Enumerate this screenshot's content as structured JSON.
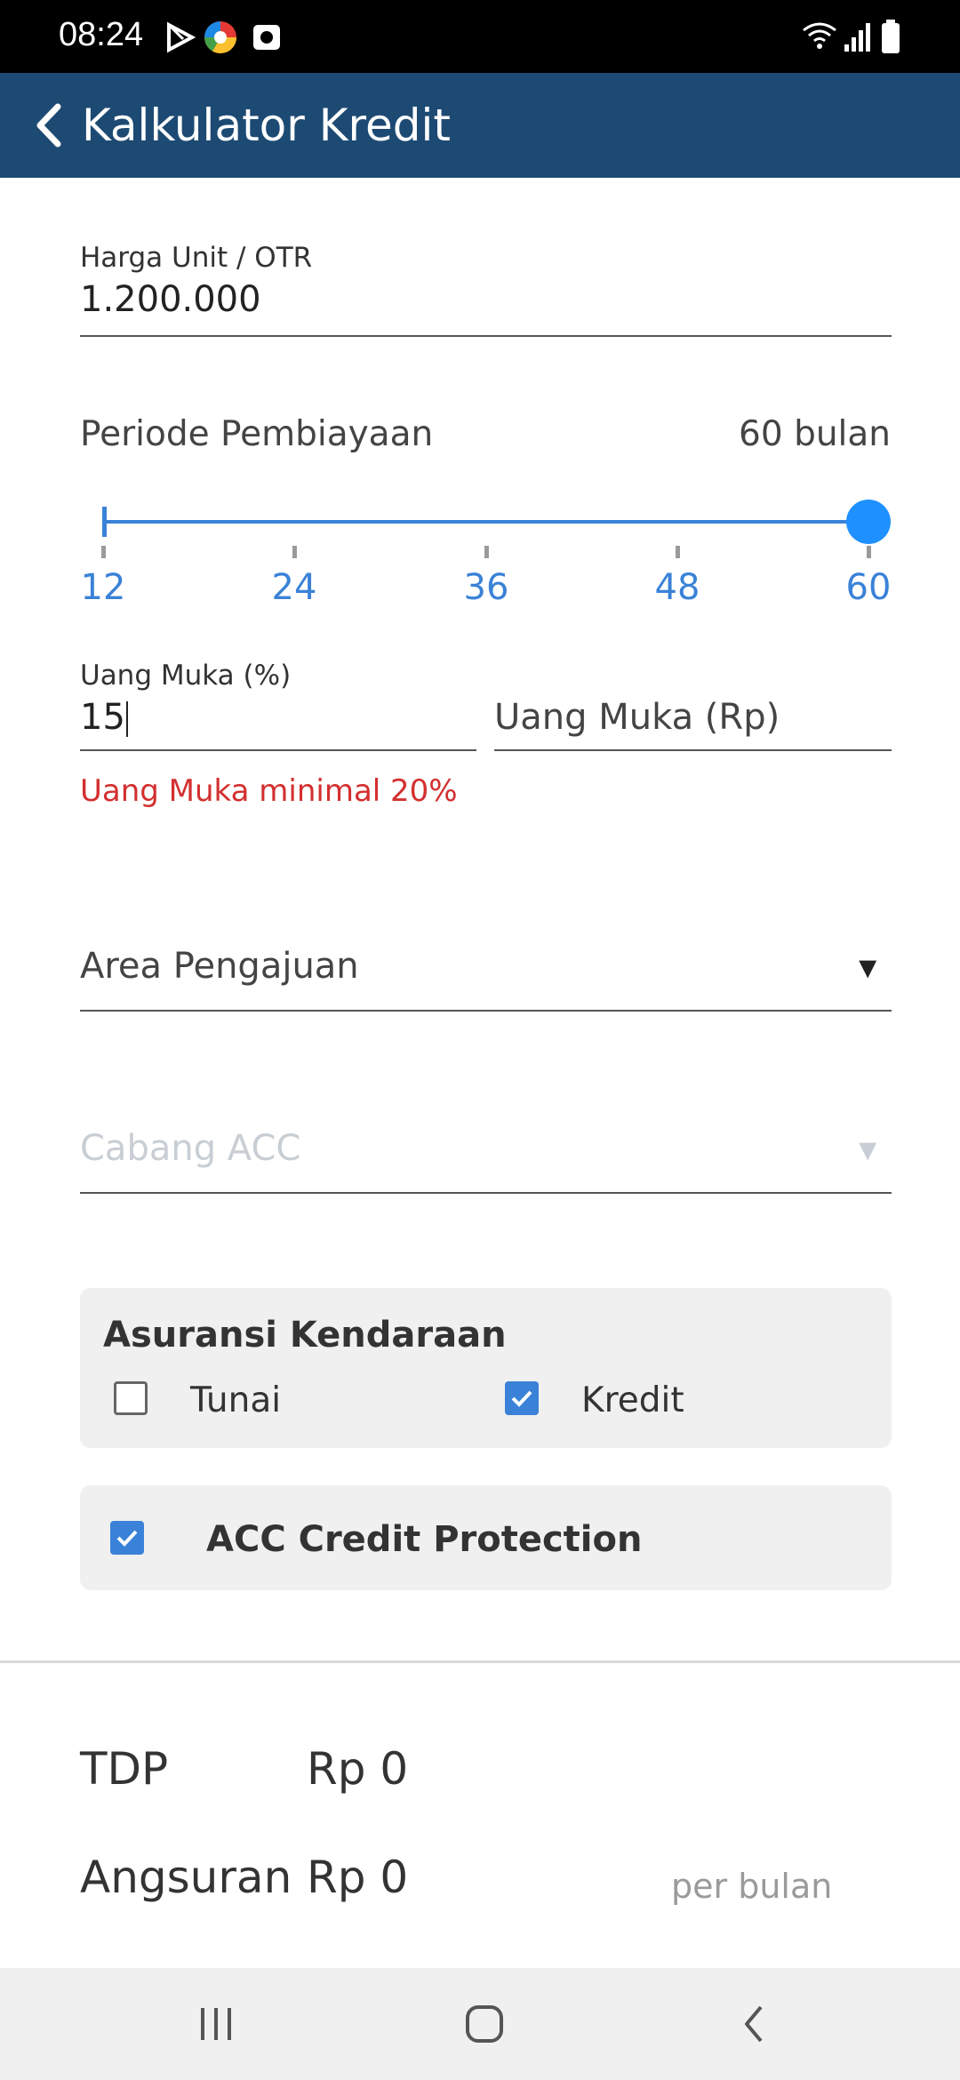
{
  "status_bar": {
    "time": "08:24",
    "icons": [
      "play-store-icon",
      "chrome-icon",
      "camera-icon",
      "wifi-icon",
      "signal-icon",
      "battery-icon"
    ]
  },
  "app_bar": {
    "title": "Kalkulator Kredit",
    "color": "#1d4a73"
  },
  "form": {
    "harga_unit": {
      "label": "Harga Unit / OTR",
      "value": "1.200.000"
    },
    "periode": {
      "label": "Periode Pembiayaan",
      "value_text": "60 bulan",
      "slider": {
        "min": 12,
        "max": 60,
        "value": 60,
        "ticks": [
          "12",
          "24",
          "36",
          "48",
          "60"
        ]
      }
    },
    "uang_muka_pct": {
      "label": "Uang Muka (%)",
      "value": "15"
    },
    "uang_muka_rp": {
      "placeholder": "Uang Muka (Rp)"
    },
    "error": "Uang Muka minimal 20%",
    "area": {
      "placeholder": "Area Pengajuan",
      "arrow": "▼"
    },
    "cabang": {
      "placeholder": "Cabang ACC",
      "arrow": "▼"
    }
  },
  "asuransi": {
    "title": "Asuransi Kendaraan",
    "options": [
      {
        "label": "Tunai",
        "checked": false
      },
      {
        "label": "Kredit",
        "checked": true
      }
    ]
  },
  "protection": {
    "label": "ACC Credit Protection",
    "checked": true
  },
  "summary": {
    "tdp_label": "TDP",
    "tdp_value": "Rp 0",
    "angsuran_label": "Angsuran",
    "angsuran_value": "Rp 0",
    "per_bulan": "per bulan"
  },
  "nav_bar": {
    "buttons": [
      "recents-icon",
      "home-icon",
      "back-icon"
    ]
  },
  "colors": {
    "accent": "#3a82d8",
    "error": "#d32f2f",
    "card_bg": "#f0f0f0"
  }
}
